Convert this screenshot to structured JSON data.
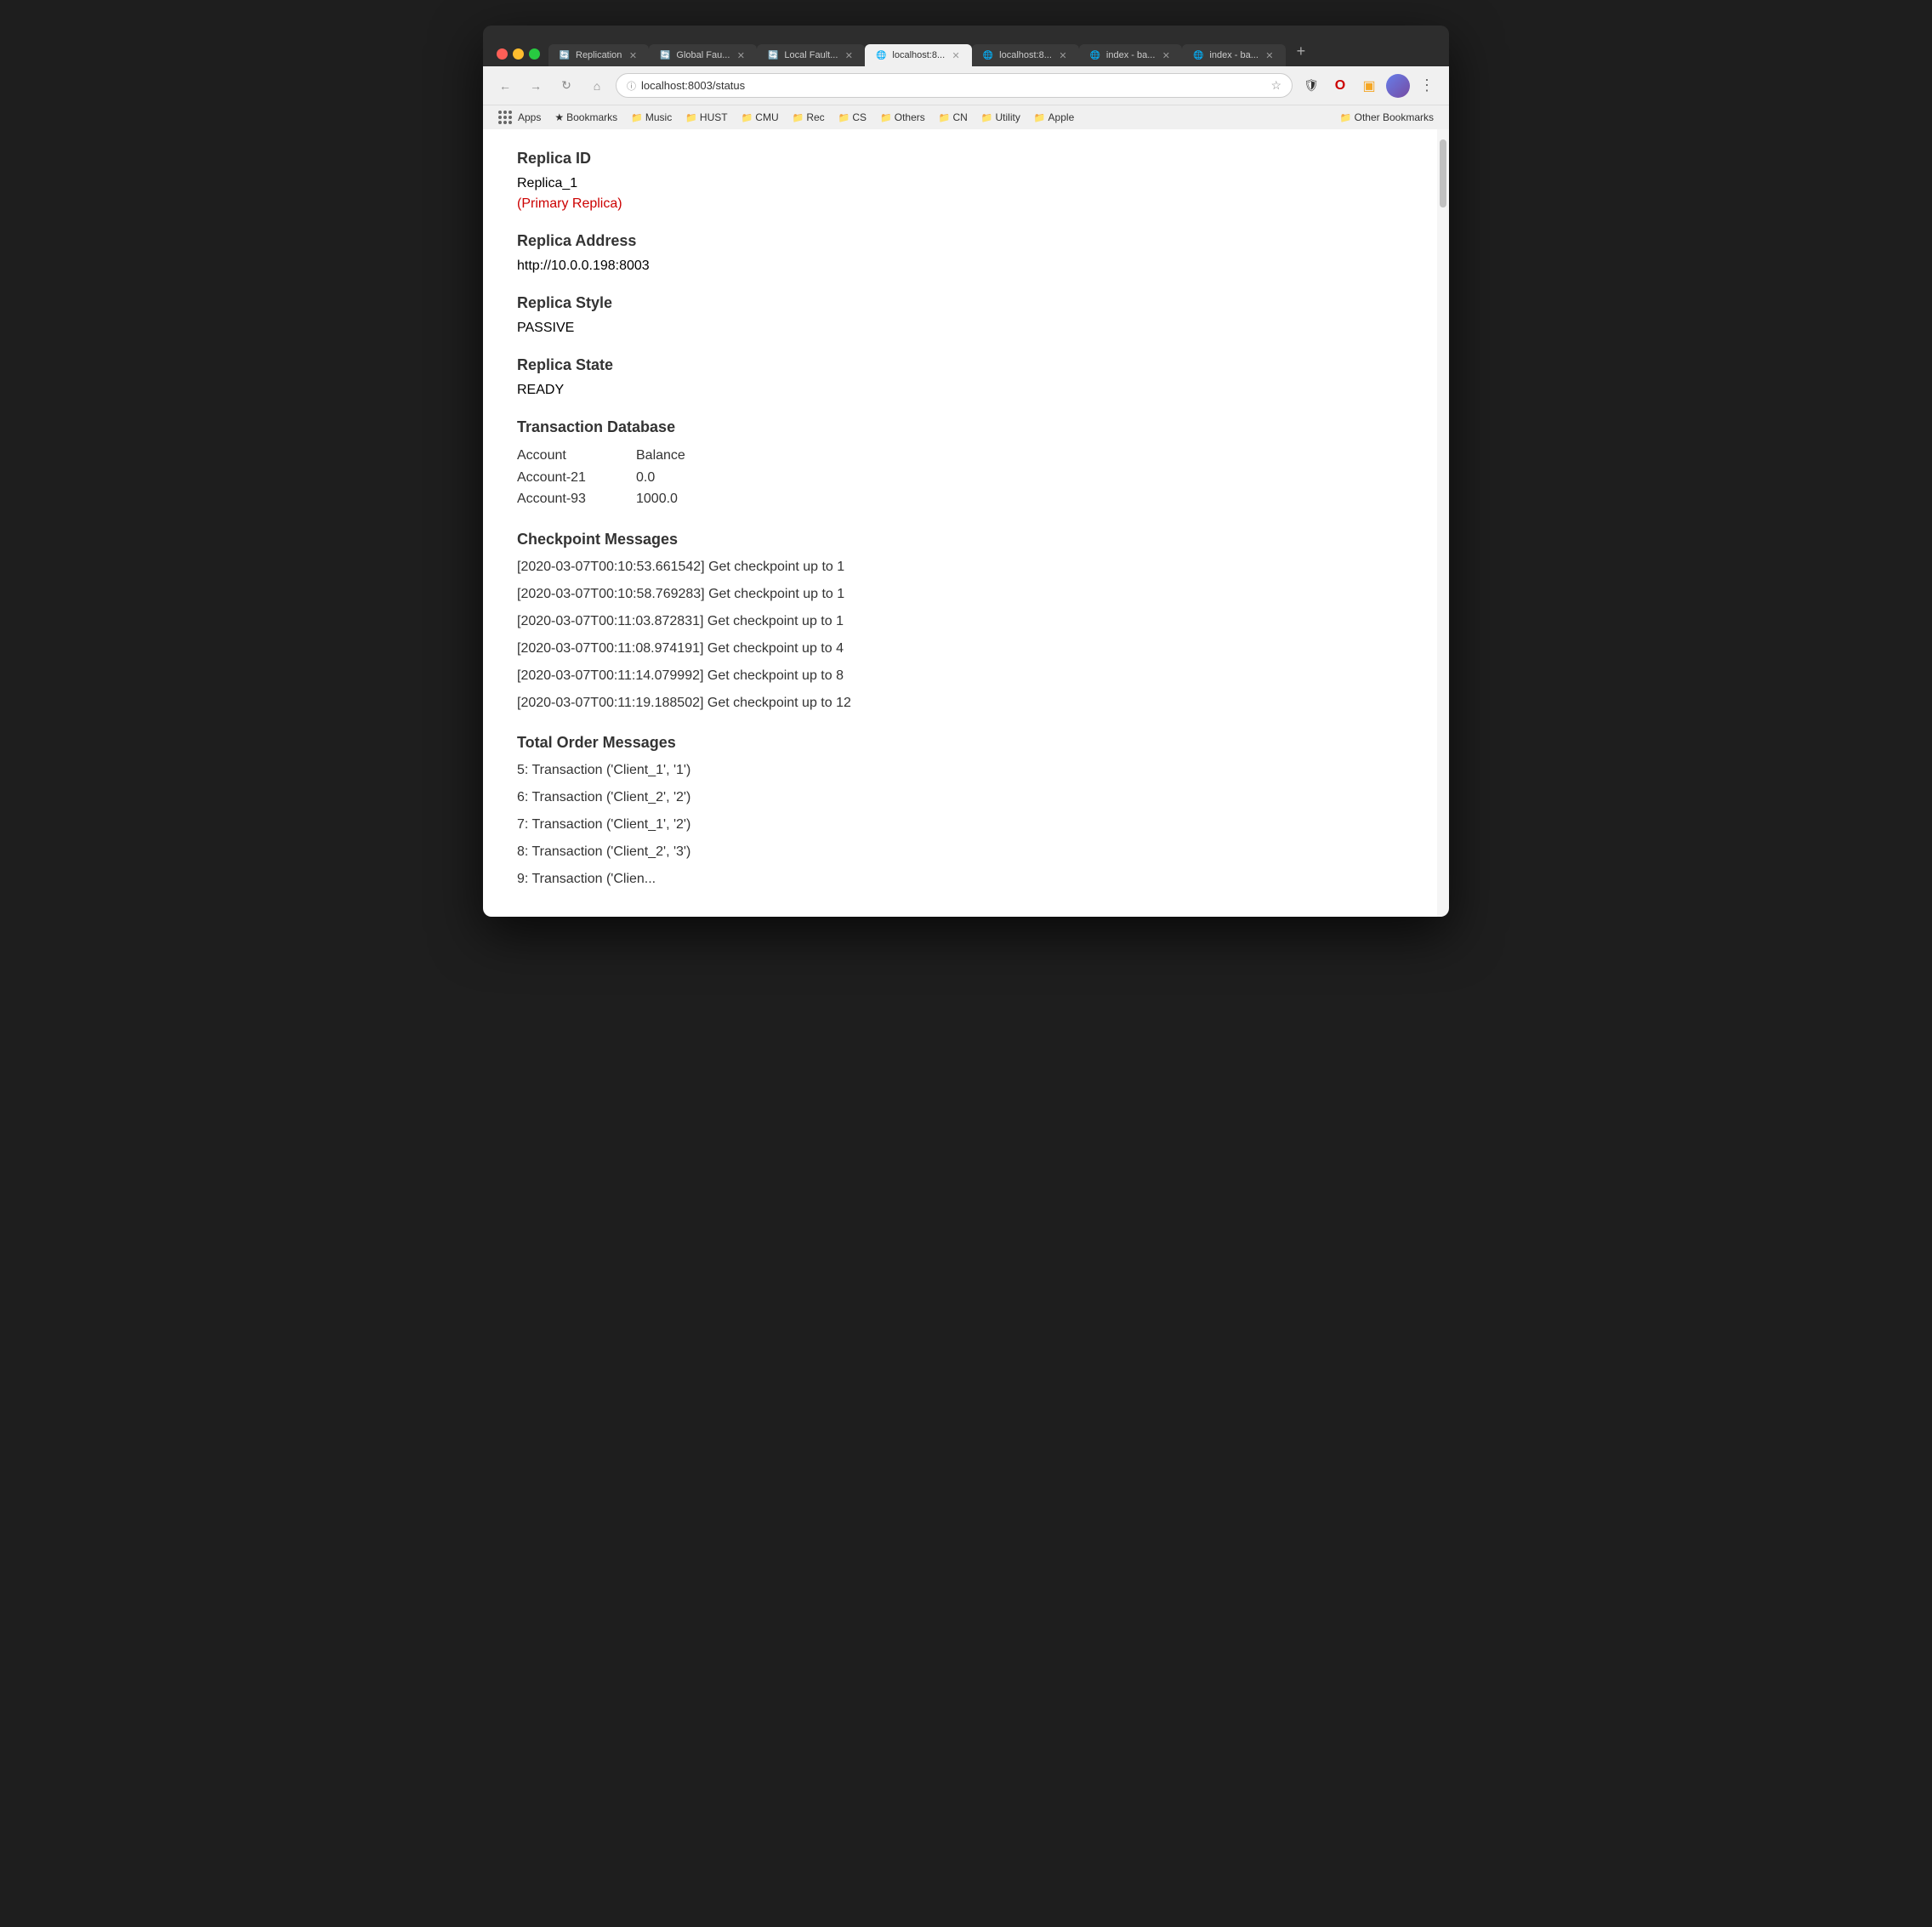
{
  "browser": {
    "tabs": [
      {
        "id": "tab-1",
        "title": "Replication",
        "favicon": "🔄",
        "active": false
      },
      {
        "id": "tab-2",
        "title": "Global Fau...",
        "favicon": "🔄",
        "active": false
      },
      {
        "id": "tab-3",
        "title": "Local Fault...",
        "favicon": "🔄",
        "active": false
      },
      {
        "id": "tab-4",
        "title": "localhost:8...",
        "favicon": "🌐",
        "active": true
      },
      {
        "id": "tab-5",
        "title": "localhost:8...",
        "favicon": "🌐",
        "active": false
      },
      {
        "id": "tab-6",
        "title": "index - ba...",
        "favicon": "🌐",
        "active": false
      },
      {
        "id": "tab-7",
        "title": "index - ba...",
        "favicon": "🌐",
        "active": false
      }
    ],
    "new_tab_label": "+",
    "address": "localhost:8003/status",
    "address_icon": "🔒",
    "bookmarks": [
      {
        "label": "Apps",
        "type": "apps"
      },
      {
        "label": "Bookmarks",
        "type": "folder",
        "icon": "★"
      },
      {
        "label": "Music",
        "type": "folder"
      },
      {
        "label": "HUST",
        "type": "folder"
      },
      {
        "label": "CMU",
        "type": "folder"
      },
      {
        "label": "Rec",
        "type": "folder"
      },
      {
        "label": "CS",
        "type": "folder"
      },
      {
        "label": "Others",
        "type": "folder"
      },
      {
        "label": "CN",
        "type": "folder"
      },
      {
        "label": "Utility",
        "type": "folder"
      },
      {
        "label": "Apple",
        "type": "folder"
      },
      {
        "label": "Other Bookmarks",
        "type": "folder"
      }
    ]
  },
  "page": {
    "replica_id_label": "Replica ID",
    "replica_id_value": "Replica_1",
    "primary_replica_label": "(Primary Replica)",
    "replica_address_label": "Replica Address",
    "replica_address_value": "http://10.0.0.198:8003",
    "replica_style_label": "Replica Style",
    "replica_style_value": "PASSIVE",
    "replica_state_label": "Replica State",
    "replica_state_value": "READY",
    "transaction_db_label": "Transaction Database",
    "db_headers": [
      "Account",
      "Balance"
    ],
    "db_rows": [
      {
        "account": "Account-21",
        "balance": "0.0"
      },
      {
        "account": "Account-93",
        "balance": "1000.0"
      }
    ],
    "checkpoint_label": "Checkpoint Messages",
    "checkpoint_messages": [
      "[2020-03-07T00:10:53.661542] Get checkpoint up to 1",
      "[2020-03-07T00:10:58.769283] Get checkpoint up to 1",
      "[2020-03-07T00:11:03.872831] Get checkpoint up to 1",
      "[2020-03-07T00:11:08.974191] Get checkpoint up to 4",
      "[2020-03-07T00:11:14.079992] Get checkpoint up to 8",
      "[2020-03-07T00:11:19.188502] Get checkpoint up to 12"
    ],
    "total_order_label": "Total Order Messages",
    "order_messages": [
      "5: Transaction ('Client_1', '1')",
      "6: Transaction ('Client_2', '2')",
      "7: Transaction ('Client_1', '2')",
      "8: Transaction ('Client_2', '3')",
      "9: Transaction ('Clien..."
    ]
  }
}
